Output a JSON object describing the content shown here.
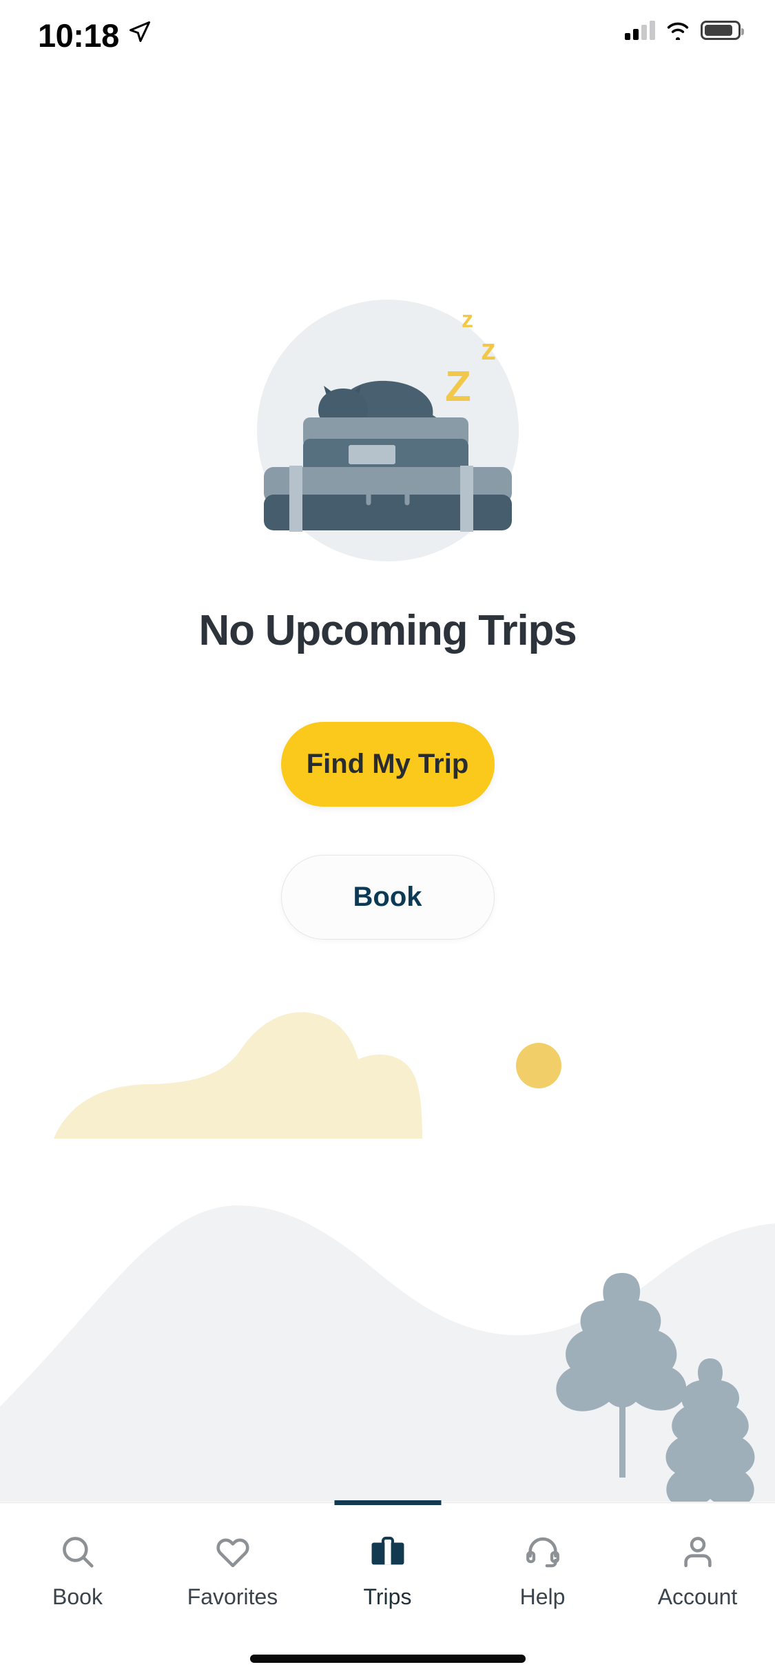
{
  "status_bar": {
    "time": "10:18",
    "location_icon": "location-arrow-icon",
    "cellular_icon": "cellular-signal-icon",
    "wifi_icon": "wifi-icon",
    "battery_icon": "battery-icon"
  },
  "illustration": {
    "name": "sleeping-cat-on-luggage-illustration",
    "sleep_marks": [
      "z",
      "z",
      "Z"
    ],
    "circle_color": "#ebeff1",
    "cat_color": "#4b6275",
    "luggage_dark_color": "#455b6b",
    "luggage_light_color": "#8a9ba8",
    "zzz_color": "#f2c84b"
  },
  "main": {
    "title": "No Upcoming Trips",
    "primary_button": "Find My Trip",
    "secondary_button": "Book"
  },
  "scene": {
    "cloud_color": "#f8efce",
    "sun_color": "#f2ce68",
    "hill_color": "#f0f2f4",
    "tree_color": "#9fafba"
  },
  "colors": {
    "accent_yellow": "#fbc81c",
    "navy": "#12394f",
    "title_text": "#2d333a",
    "tab_inactive": "#8c9196"
  },
  "tab_bar": {
    "active_index": 2,
    "items": [
      {
        "label": "Book",
        "icon": "search-icon",
        "active": false
      },
      {
        "label": "Favorites",
        "icon": "heart-icon",
        "active": false
      },
      {
        "label": "Trips",
        "icon": "briefcase-icon",
        "active": true
      },
      {
        "label": "Help",
        "icon": "headset-icon",
        "active": false
      },
      {
        "label": "Account",
        "icon": "person-icon",
        "active": false
      }
    ]
  }
}
